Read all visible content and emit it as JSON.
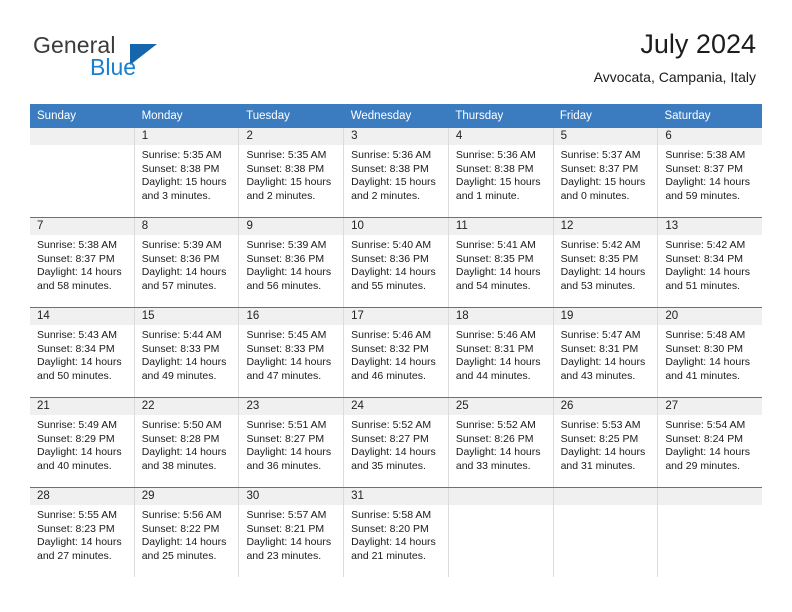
{
  "branding": {
    "logo_primary": "General",
    "logo_secondary": "Blue",
    "logo_mark": "triangle-icon",
    "colors": {
      "logo_primary": "#3b3b3b",
      "logo_secondary": "#1880d0",
      "logo_mark": "#1566ad",
      "header_blue": "#3b7cc0",
      "day_band_gray": "#f0f0f0",
      "cell_border": "#dcdcdc"
    }
  },
  "header": {
    "title": "July 2024",
    "subtitle": "Avvocata, Campania, Italy"
  },
  "calendar": {
    "weekdays": [
      "Sunday",
      "Monday",
      "Tuesday",
      "Wednesday",
      "Thursday",
      "Friday",
      "Saturday"
    ],
    "weeks": [
      [
        {
          "day": "",
          "empty": true
        },
        {
          "day": "1",
          "sunrise": "Sunrise: 5:35 AM",
          "sunset": "Sunset: 8:38 PM",
          "daylight": "Daylight: 15 hours and 3 minutes."
        },
        {
          "day": "2",
          "sunrise": "Sunrise: 5:35 AM",
          "sunset": "Sunset: 8:38 PM",
          "daylight": "Daylight: 15 hours and 2 minutes."
        },
        {
          "day": "3",
          "sunrise": "Sunrise: 5:36 AM",
          "sunset": "Sunset: 8:38 PM",
          "daylight": "Daylight: 15 hours and 2 minutes."
        },
        {
          "day": "4",
          "sunrise": "Sunrise: 5:36 AM",
          "sunset": "Sunset: 8:38 PM",
          "daylight": "Daylight: 15 hours and 1 minute."
        },
        {
          "day": "5",
          "sunrise": "Sunrise: 5:37 AM",
          "sunset": "Sunset: 8:37 PM",
          "daylight": "Daylight: 15 hours and 0 minutes."
        },
        {
          "day": "6",
          "sunrise": "Sunrise: 5:38 AM",
          "sunset": "Sunset: 8:37 PM",
          "daylight": "Daylight: 14 hours and 59 minutes."
        }
      ],
      [
        {
          "day": "7",
          "sunrise": "Sunrise: 5:38 AM",
          "sunset": "Sunset: 8:37 PM",
          "daylight": "Daylight: 14 hours and 58 minutes."
        },
        {
          "day": "8",
          "sunrise": "Sunrise: 5:39 AM",
          "sunset": "Sunset: 8:36 PM",
          "daylight": "Daylight: 14 hours and 57 minutes."
        },
        {
          "day": "9",
          "sunrise": "Sunrise: 5:39 AM",
          "sunset": "Sunset: 8:36 PM",
          "daylight": "Daylight: 14 hours and 56 minutes."
        },
        {
          "day": "10",
          "sunrise": "Sunrise: 5:40 AM",
          "sunset": "Sunset: 8:36 PM",
          "daylight": "Daylight: 14 hours and 55 minutes."
        },
        {
          "day": "11",
          "sunrise": "Sunrise: 5:41 AM",
          "sunset": "Sunset: 8:35 PM",
          "daylight": "Daylight: 14 hours and 54 minutes."
        },
        {
          "day": "12",
          "sunrise": "Sunrise: 5:42 AM",
          "sunset": "Sunset: 8:35 PM",
          "daylight": "Daylight: 14 hours and 53 minutes."
        },
        {
          "day": "13",
          "sunrise": "Sunrise: 5:42 AM",
          "sunset": "Sunset: 8:34 PM",
          "daylight": "Daylight: 14 hours and 51 minutes."
        }
      ],
      [
        {
          "day": "14",
          "sunrise": "Sunrise: 5:43 AM",
          "sunset": "Sunset: 8:34 PM",
          "daylight": "Daylight: 14 hours and 50 minutes."
        },
        {
          "day": "15",
          "sunrise": "Sunrise: 5:44 AM",
          "sunset": "Sunset: 8:33 PM",
          "daylight": "Daylight: 14 hours and 49 minutes."
        },
        {
          "day": "16",
          "sunrise": "Sunrise: 5:45 AM",
          "sunset": "Sunset: 8:33 PM",
          "daylight": "Daylight: 14 hours and 47 minutes."
        },
        {
          "day": "17",
          "sunrise": "Sunrise: 5:46 AM",
          "sunset": "Sunset: 8:32 PM",
          "daylight": "Daylight: 14 hours and 46 minutes."
        },
        {
          "day": "18",
          "sunrise": "Sunrise: 5:46 AM",
          "sunset": "Sunset: 8:31 PM",
          "daylight": "Daylight: 14 hours and 44 minutes."
        },
        {
          "day": "19",
          "sunrise": "Sunrise: 5:47 AM",
          "sunset": "Sunset: 8:31 PM",
          "daylight": "Daylight: 14 hours and 43 minutes."
        },
        {
          "day": "20",
          "sunrise": "Sunrise: 5:48 AM",
          "sunset": "Sunset: 8:30 PM",
          "daylight": "Daylight: 14 hours and 41 minutes."
        }
      ],
      [
        {
          "day": "21",
          "sunrise": "Sunrise: 5:49 AM",
          "sunset": "Sunset: 8:29 PM",
          "daylight": "Daylight: 14 hours and 40 minutes."
        },
        {
          "day": "22",
          "sunrise": "Sunrise: 5:50 AM",
          "sunset": "Sunset: 8:28 PM",
          "daylight": "Daylight: 14 hours and 38 minutes."
        },
        {
          "day": "23",
          "sunrise": "Sunrise: 5:51 AM",
          "sunset": "Sunset: 8:27 PM",
          "daylight": "Daylight: 14 hours and 36 minutes."
        },
        {
          "day": "24",
          "sunrise": "Sunrise: 5:52 AM",
          "sunset": "Sunset: 8:27 PM",
          "daylight": "Daylight: 14 hours and 35 minutes."
        },
        {
          "day": "25",
          "sunrise": "Sunrise: 5:52 AM",
          "sunset": "Sunset: 8:26 PM",
          "daylight": "Daylight: 14 hours and 33 minutes."
        },
        {
          "day": "26",
          "sunrise": "Sunrise: 5:53 AM",
          "sunset": "Sunset: 8:25 PM",
          "daylight": "Daylight: 14 hours and 31 minutes."
        },
        {
          "day": "27",
          "sunrise": "Sunrise: 5:54 AM",
          "sunset": "Sunset: 8:24 PM",
          "daylight": "Daylight: 14 hours and 29 minutes."
        }
      ],
      [
        {
          "day": "28",
          "sunrise": "Sunrise: 5:55 AM",
          "sunset": "Sunset: 8:23 PM",
          "daylight": "Daylight: 14 hours and 27 minutes."
        },
        {
          "day": "29",
          "sunrise": "Sunrise: 5:56 AM",
          "sunset": "Sunset: 8:22 PM",
          "daylight": "Daylight: 14 hours and 25 minutes."
        },
        {
          "day": "30",
          "sunrise": "Sunrise: 5:57 AM",
          "sunset": "Sunset: 8:21 PM",
          "daylight": "Daylight: 14 hours and 23 minutes."
        },
        {
          "day": "31",
          "sunrise": "Sunrise: 5:58 AM",
          "sunset": "Sunset: 8:20 PM",
          "daylight": "Daylight: 14 hours and 21 minutes."
        },
        {
          "day": "",
          "empty": true
        },
        {
          "day": "",
          "empty": true
        },
        {
          "day": "",
          "empty": true
        }
      ]
    ]
  }
}
